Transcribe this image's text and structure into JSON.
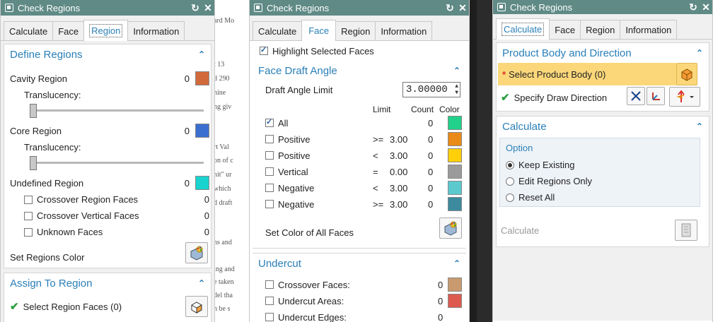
{
  "background_doc": {
    "lines": [
      "ard Mo",
      "t 13",
      "d 290",
      "hine",
      "ng giv",
      "rt Val",
      "on of c",
      "nit\" ur",
      "which",
      "d draft",
      "ns and",
      "ing and",
      "e taken",
      "del tha",
      "n be s"
    ]
  },
  "dialog1": {
    "title": "Check Regions",
    "tabs": [
      "Calculate",
      "Face",
      "Region",
      "Information"
    ],
    "active_tab": "Region",
    "define": {
      "header": "Define Regions",
      "cavity_label": "Cavity Region",
      "cavity_count": "0",
      "cavity_color": "#d2693b",
      "translucency_label": "Translucency:",
      "core_label": "Core Region",
      "core_count": "0",
      "core_color": "#3a6fd0",
      "translucency_label2": "Translucency:",
      "undefined_label": "Undefined Region",
      "undefined_count": "0",
      "undefined_color": "#19d3cf",
      "crossover_region_label": "Crossover Region Faces",
      "crossover_region_count": "0",
      "crossover_vertical_label": "Crossover Vertical Faces",
      "crossover_vertical_count": "0",
      "unknown_label": "Unknown Faces",
      "unknown_count": "0",
      "set_color_label": "Set Regions Color"
    },
    "assign": {
      "header": "Assign To Region",
      "select_label": "Select Region Faces (0)"
    }
  },
  "dialog2": {
    "title": "Check Regions",
    "tabs": [
      "Calculate",
      "Face",
      "Region",
      "Information"
    ],
    "active_tab": "Face",
    "highlight_label": "Highlight Selected Faces",
    "draft": {
      "header": "Face Draft Angle",
      "limit_label": "Draft Angle Limit",
      "limit_value": "3.00000",
      "col_limit": "Limit",
      "col_count": "Count",
      "col_color": "Color",
      "rows": [
        {
          "label": "All",
          "op": "",
          "val": "",
          "count": "0",
          "color": "#21d08a",
          "checked": true
        },
        {
          "label": "Positive",
          "op": ">=",
          "val": "3.00",
          "count": "0",
          "color": "#ea8a17",
          "checked": false
        },
        {
          "label": "Positive",
          "op": "<",
          "val": "3.00",
          "count": "0",
          "color": "#ffcf0a",
          "checked": false
        },
        {
          "label": "Vertical",
          "op": "=",
          "val": "0.00",
          "count": "0",
          "color": "#9b9b9b",
          "checked": false
        },
        {
          "label": "Negative",
          "op": "<",
          "val": "3.00",
          "count": "0",
          "color": "#5cc9cf",
          "checked": false
        },
        {
          "label": "Negative",
          "op": ">=",
          "val": "3.00",
          "count": "0",
          "color": "#3c8a9e",
          "checked": false
        }
      ],
      "set_color_label": "Set Color of All Faces"
    },
    "undercut": {
      "header": "Undercut",
      "rows": [
        {
          "label": "Crossover Faces:",
          "count": "0",
          "color": "#c99a6e"
        },
        {
          "label": "Undercut Areas:",
          "count": "0",
          "color": "#dd5a4f"
        },
        {
          "label": "Undercut Edges:",
          "count": "0"
        }
      ]
    }
  },
  "dialog3": {
    "title": "Check Regions",
    "tabs": [
      "Calculate",
      "Face",
      "Region",
      "Information"
    ],
    "active_tab": "Calculate",
    "product": {
      "header": "Product Body and Direction",
      "select_body_label": "Select Product Body (0)",
      "draw_dir_label": "Specify Draw Direction"
    },
    "calculate": {
      "header": "Calculate",
      "option_label": "Option",
      "options": [
        "Keep Existing",
        "Edit Regions Only",
        "Reset All"
      ],
      "selected": "Keep Existing",
      "calc_label": "Calculate"
    }
  }
}
